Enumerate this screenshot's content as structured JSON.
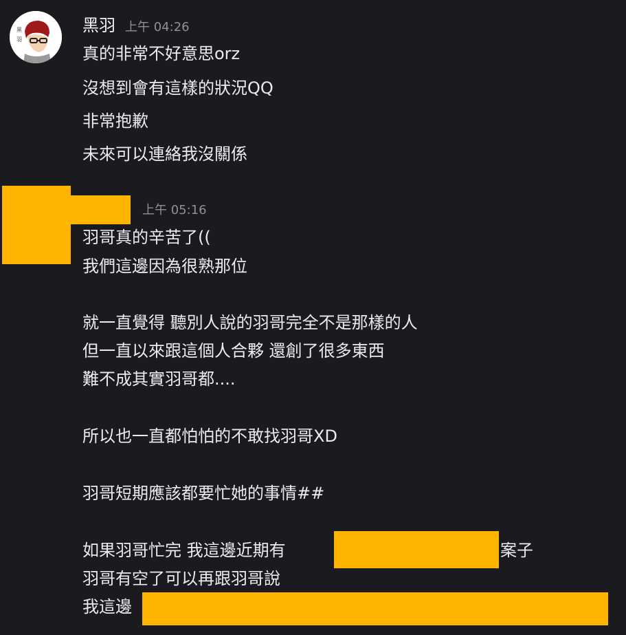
{
  "colors": {
    "background": "#1b1b1f",
    "text": "#ececef",
    "timestamp": "#8f8f96",
    "redaction": "#ffb400"
  },
  "messages": [
    {
      "username": "黑羽",
      "timestamp": "上午 04:26",
      "avatar_icon": "user-avatar-illustration",
      "lines": [
        "真的非常不好意思orz",
        "沒想到會有這樣的狀況QQ",
        "非常抱歉",
        "未來可以連絡我沒關係"
      ]
    },
    {
      "username": "",
      "timestamp": "上午 05:16",
      "avatar_icon": "redacted-avatar",
      "lines": [
        "羽哥真的辛苦了((",
        "我們這邊因為很熟那位",
        "",
        "就一直覺得 聽別人說的羽哥完全不是那樣的人",
        "但一直以來跟這個人合夥 還創了很多東西",
        "難不成其實羽哥都....",
        "",
        "所以也一直都怕怕的不敢找羽哥XD",
        "",
        "羽哥短期應該都要忙她的事情##",
        "",
        "如果羽哥忙完 我這邊近期有",
        "案子",
        "羽哥有空了可以再跟羽哥說",
        "我這邊"
      ]
    }
  ]
}
